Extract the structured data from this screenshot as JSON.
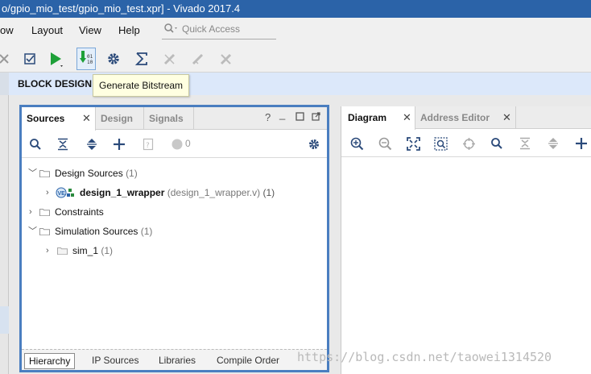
{
  "window": {
    "title": "o/gpio_mio_test/gpio_mio_test.xpr] - Vivado 2017.4"
  },
  "menu": {
    "items": [
      "ow",
      "Layout",
      "View",
      "Help"
    ]
  },
  "quick_access": {
    "placeholder": "Quick Access"
  },
  "toolbar": {
    "icons": [
      "close-icon",
      "checkbox-icon",
      "run-icon",
      "generate-bitstream-icon",
      "settings-gear-icon",
      "sigma-icon",
      "disabled-tool-1-icon",
      "disabled-tool-2-icon",
      "disabled-tool-3-icon"
    ],
    "tooltip": "Generate Bitstream"
  },
  "header": {
    "title": "BLOCK DESIGN -"
  },
  "sources_panel": {
    "tabs": [
      {
        "label": "Sources",
        "active": true
      },
      {
        "label": "Design",
        "active": false
      },
      {
        "label": "Signals",
        "active": false
      }
    ],
    "window_controls": [
      "?",
      "_",
      "□",
      "⇱"
    ],
    "status_count": "0",
    "tree": [
      {
        "label": "Design Sources",
        "count": "(1)",
        "expanded": true,
        "level": 0
      },
      {
        "label": "design_1_wrapper",
        "detail": "(design_1_wrapper.v)",
        "count": "(1)",
        "expanded": false,
        "level": 1
      },
      {
        "label": "Constraints",
        "count": "",
        "expanded": false,
        "level": 0
      },
      {
        "label": "Simulation Sources",
        "count": "(1)",
        "expanded": true,
        "level": 0
      },
      {
        "label": "sim_1",
        "count": "(1)",
        "expanded": false,
        "level": 1
      }
    ],
    "bottom_tabs": [
      {
        "label": "Hierarchy",
        "active": true
      },
      {
        "label": "IP Sources",
        "active": false
      },
      {
        "label": "Libraries",
        "active": false
      },
      {
        "label": "Compile Order",
        "active": false
      }
    ]
  },
  "diagram_panel": {
    "tabs": [
      {
        "label": "Diagram",
        "active": true
      },
      {
        "label": "Address Editor",
        "active": false
      }
    ]
  },
  "watermark": "https://blog.csdn.net/taowei1314520",
  "colors": {
    "accent": "#4a7ec0",
    "titlebar": "#2b63a8",
    "header_bg": "#dce8fa",
    "tooltip_bg": "#ffffe1"
  }
}
